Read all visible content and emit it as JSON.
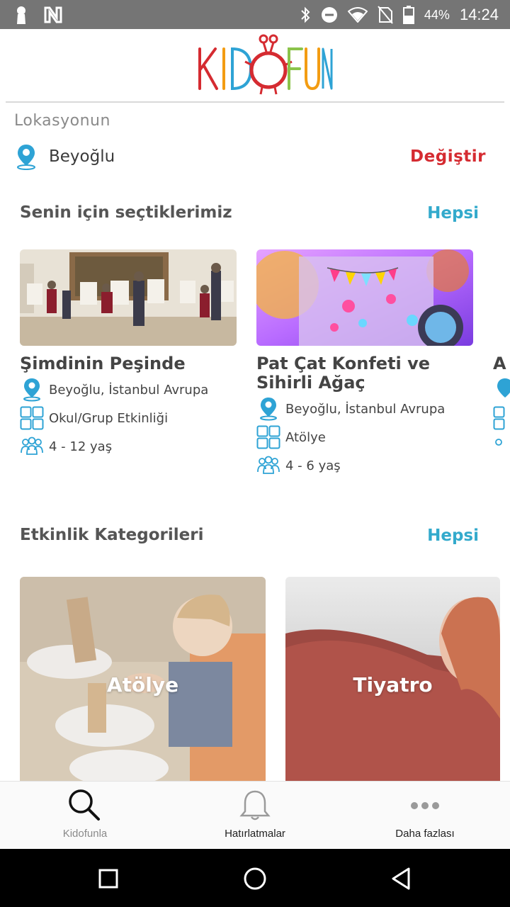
{
  "status_bar": {
    "battery": "44%",
    "time": "14:24"
  },
  "brand": {
    "logo_text": "KIDOFUN",
    "colors": [
      "#d52b31",
      "#f39c12",
      "#2ea3d5",
      "#8bc34a"
    ]
  },
  "location": {
    "label": "Lokasyonun",
    "value": "Beyoğlu",
    "change": "Değiştir"
  },
  "picked": {
    "title": "Senin için seçtiklerimiz",
    "all": "Hepsi",
    "cards": [
      {
        "title": "Şimdinin Peşinde",
        "location": "Beyoğlu, İstanbul Avrupa",
        "category": "Okul/Grup Etkinliği",
        "age": "4 - 12 yaş"
      },
      {
        "title": "Pat Çat Konfeti ve Sihirli Ağaç",
        "location": "Beyoğlu, İstanbul Avrupa",
        "category": "Atölye",
        "age": "4 - 6 yaş"
      },
      {
        "title": "A"
      }
    ]
  },
  "categories": {
    "title": "Etkinlik Kategorileri",
    "all": "Hepsi",
    "items": [
      {
        "label": "Atölye"
      },
      {
        "label": "Tiyatro"
      }
    ]
  },
  "bottom_nav": [
    {
      "label": "Kidofunla",
      "icon": "search-icon"
    },
    {
      "label": "Hatırlatmalar",
      "icon": "bell-icon"
    },
    {
      "label": "Daha fazlası",
      "icon": "more-icon"
    }
  ],
  "accent": "#33aacc",
  "danger": "#d52b31"
}
